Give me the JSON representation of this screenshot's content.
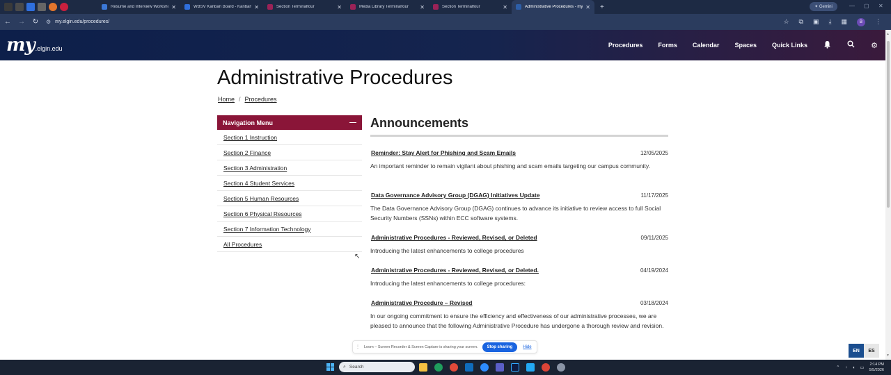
{
  "browser": {
    "tabs": [
      {
        "label": "Resume and Interview Worksho",
        "color": "#3b78d8",
        "active": false
      },
      {
        "label": "WBSV Kanban Board - Kanban",
        "color": "#2f6fde",
        "active": false
      },
      {
        "label": "Section Terminalfour",
        "color": "#9b2257",
        "active": false
      },
      {
        "label": "Media Library Terminalfour",
        "color": "#9b2257",
        "active": false
      },
      {
        "label": "Section Terminalfour",
        "color": "#9b2257",
        "active": false
      },
      {
        "label": "Administrative Procedures - my",
        "color": "#2d5ea8",
        "active": true
      }
    ],
    "gemini_label": "Gemini",
    "url": "my.elgin.edu/procedures/",
    "profile_initial": "B"
  },
  "site": {
    "logo_my": "my",
    "logo_domain": ".elgin.edu",
    "nav": [
      "Procedures",
      "Forms",
      "Calendar",
      "Spaces",
      "Quick Links"
    ],
    "header_icons": [
      "bell-icon",
      "search-icon",
      "settings-icon"
    ]
  },
  "page": {
    "title": "Administrative Procedures",
    "breadcrumb": {
      "home": "Home",
      "separator": "/",
      "current": "Procedures"
    }
  },
  "nav_menu": {
    "heading": "Navigation Menu",
    "collapse_symbol": "—",
    "items": [
      "Section 1 Instruction",
      "Section 2 Finance",
      "Section 3 Administration",
      "Section 4 Student Services",
      "Section 5 Human Resources",
      "Section 6 Physical Resources",
      "Section 7 Information Technology",
      "All Procedures"
    ]
  },
  "announcements": {
    "heading": "Announcements",
    "items": [
      {
        "title": "Reminder: Stay Alert for Phishing and Scam Emails",
        "date": "12/05/2025",
        "desc": "An important reminder to remain vigilant about phishing and scam emails targeting our campus community."
      },
      {
        "title": "Data Governance Advisory Group (DGAG) Initiatives Update",
        "date": "11/17/2025",
        "desc": "The Data Governance Advisory Group (DGAG) continues to advance its initiative to review access to full Social Security Numbers (SSNs) within ECC software systems."
      },
      {
        "title": "Administrative Procedures - Reviewed, Revised, or Deleted",
        "date": "09/11/2025",
        "desc": "Introducing the latest enhancements to college procedures"
      },
      {
        "title": "Administrative Procedures - Reviewed, Revised, or Deleted.",
        "date": "04/19/2024",
        "desc": "Introducing the latest enhancements to college procedures:"
      },
      {
        "title": "Administrative Procedure – Revised",
        "date": "03/18/2024",
        "desc": "In our ongoing commitment to ensure the efficiency and effectiveness of our administrative processes, we are pleased to announce that the following Administrative Procedure has undergone a thorough review and revision."
      }
    ]
  },
  "loom": {
    "text": "Loom – Screen Recorder & Screen Capture is sharing your screen.",
    "stop_label": "Stop sharing",
    "hide_label": "Hide"
  },
  "language": {
    "en": "EN",
    "es": "ES"
  },
  "taskbar": {
    "search_placeholder": "Search",
    "time": "2:14 PM",
    "date": "5/5/2026"
  }
}
